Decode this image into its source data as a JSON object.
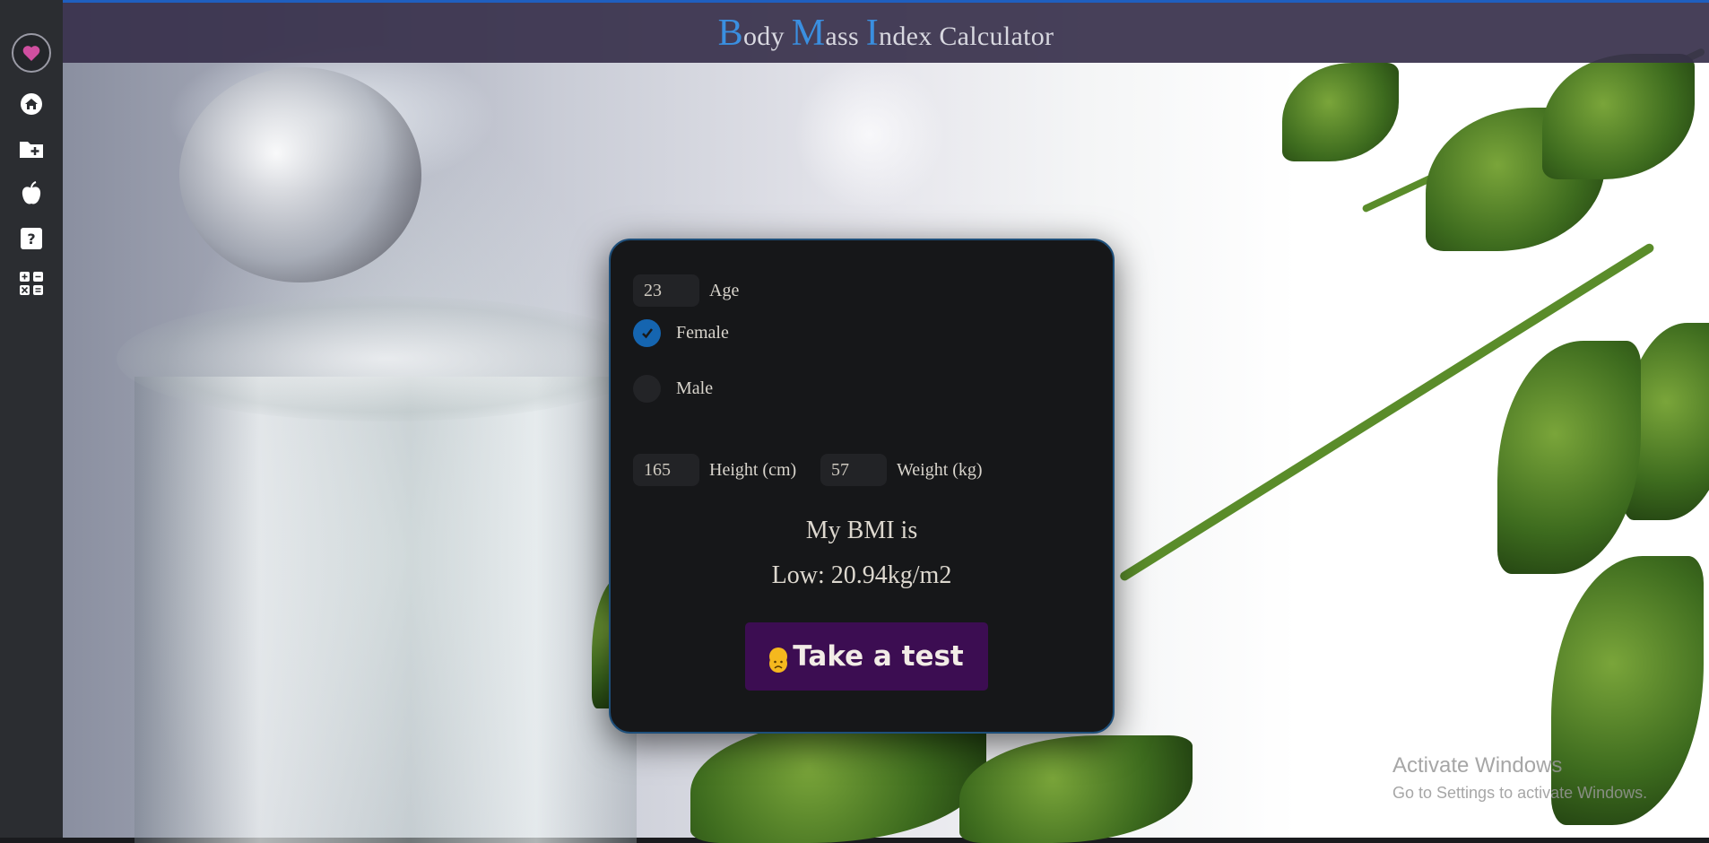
{
  "header": {
    "title_parts": [
      {
        "cap": "B",
        "rest": "ody "
      },
      {
        "cap": "M",
        "rest": "ass "
      },
      {
        "cap": "I",
        "rest": "ndex Calculator"
      }
    ]
  },
  "sidebar": {
    "logo": "heart-logo",
    "items": [
      {
        "icon": "home-icon"
      },
      {
        "icon": "folder-add-icon"
      },
      {
        "icon": "apple-icon"
      },
      {
        "icon": "question-icon"
      },
      {
        "icon": "calculator-icon"
      }
    ]
  },
  "form": {
    "age": {
      "value": "23",
      "label": "Age"
    },
    "gender": {
      "options": [
        {
          "label": "Female",
          "checked": true
        },
        {
          "label": "Male",
          "checked": false
        }
      ]
    },
    "height": {
      "value": "165",
      "label": "Height (cm)"
    },
    "weight": {
      "value": "57",
      "label": "Weight (kg)"
    }
  },
  "result": {
    "heading": "My BMI is",
    "value": "Low: 20.94kg/m2"
  },
  "button": {
    "label": "Take a test",
    "emoji": "sad-face-emoji"
  },
  "watermark": {
    "line1": "Activate Windows",
    "line2": "Go to Settings to activate Windows."
  },
  "colors": {
    "accent": "#3a8fe0",
    "radio_checked": "#1565b0",
    "button_bg": "#3c0d52",
    "card_bg": "#161719"
  }
}
